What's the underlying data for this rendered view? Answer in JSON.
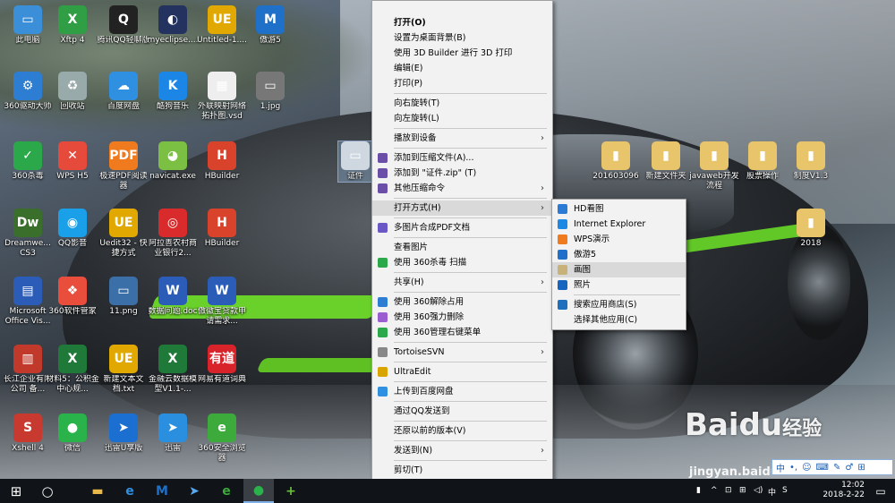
{
  "desktop_icons": [
    {
      "label": "此电脑",
      "bg": "#3a8fd8",
      "glyph": "▭"
    },
    {
      "label": "Xftp 4",
      "bg": "#2f9e44",
      "glyph": "X"
    },
    {
      "label": "腾讯QQ轻聊版",
      "bg": "#222",
      "glyph": "Q"
    },
    {
      "label": "myeclipse....",
      "bg": "#23325f",
      "glyph": "◐"
    },
    {
      "label": "Untitled-1....",
      "bg": "#e0a800",
      "glyph": "UE"
    },
    {
      "label": "傲游5",
      "bg": "#1e70c8",
      "glyph": "M"
    },
    {
      "label": "360驱动大师",
      "bg": "#2d7dd2",
      "glyph": "⚙"
    },
    {
      "label": "回收站",
      "bg": "#9aa",
      "glyph": "♻"
    },
    {
      "label": "百度网盘",
      "bg": "#2f8fe0",
      "glyph": "☁"
    },
    {
      "label": "酷狗音乐",
      "bg": "#1b86e6",
      "glyph": "K"
    },
    {
      "label": "外联映射网络拓扑图.vsd",
      "bg": "#eee",
      "glyph": "▦"
    },
    {
      "label": "1.jpg",
      "bg": "#777",
      "glyph": "▭"
    },
    {
      "label": "360杀毒",
      "bg": "#2ba84a",
      "glyph": "✓"
    },
    {
      "label": "WPS H5",
      "bg": "#e64a3b",
      "glyph": "✕"
    },
    {
      "label": "极速PDF阅读器",
      "bg": "#f07a1e",
      "glyph": "PDF"
    },
    {
      "label": "navicat.exe",
      "bg": "#7bc043",
      "glyph": "◕"
    },
    {
      "label": "HBuilder",
      "bg": "#d9432b",
      "glyph": "H"
    },
    {
      "label": "证件",
      "bg": "#cfd8e0",
      "glyph": "▭"
    },
    {
      "label": "Dreamwe... CS3",
      "bg": "#3a6e2b",
      "glyph": "Dw"
    },
    {
      "label": "QQ影音",
      "bg": "#1aa0e8",
      "glyph": "◉"
    },
    {
      "label": "Uedit32 - 快捷方式",
      "bg": "#e0a800",
      "glyph": "UE"
    },
    {
      "label": "阿拉善农村商业银行2...",
      "bg": "#d92b2b",
      "glyph": "◎"
    },
    {
      "label": "HBuilder",
      "bg": "#d9432b",
      "glyph": "H"
    },
    {
      "label": "Microsoft Office Vis...",
      "bg": "#2b5db8",
      "glyph": "▤"
    },
    {
      "label": "360软件管家",
      "bg": "#e94e3c",
      "glyph": "❖"
    },
    {
      "label": "11.png",
      "bg": "#3b6fa8",
      "glyph": "▭"
    },
    {
      "label": "数据问题.doc",
      "bg": "#2b5db8",
      "glyph": "W"
    },
    {
      "label": "傲徽宝贷款申请需求...",
      "bg": "#2b5db8",
      "glyph": "W"
    },
    {
      "label": "长江企业有限公司 备...",
      "bg": "#c0392b",
      "glyph": "▥"
    },
    {
      "label": "材料5：公积金中心规...",
      "bg": "#1f7a3a",
      "glyph": "X"
    },
    {
      "label": "新建文本文档.txt",
      "bg": "#e0a800",
      "glyph": "UE"
    },
    {
      "label": "金融云数据模型V1.1-...",
      "bg": "#1f7a3a",
      "glyph": "X"
    },
    {
      "label": "网易有道词典",
      "bg": "#d9232b",
      "glyph": "有道"
    },
    {
      "label": "Xshell 4",
      "bg": "#c83a2f",
      "glyph": "S"
    },
    {
      "label": "微信",
      "bg": "#2ab34a",
      "glyph": "●"
    },
    {
      "label": "迅雷U享版",
      "bg": "#1a6fd1",
      "glyph": "➤"
    },
    {
      "label": "迅雷",
      "bg": "#2b8fe0",
      "glyph": "➤"
    },
    {
      "label": "360安全浏览器",
      "bg": "#3cab3c",
      "glyph": "e"
    },
    {
      "label": "201603096",
      "bg": "#e8c46a",
      "glyph": "▮"
    },
    {
      "label": "新建文件夹",
      "bg": "#e8c46a",
      "glyph": "▮"
    },
    {
      "label": "javaweb开发流程",
      "bg": "#e8c46a",
      "glyph": "▮"
    },
    {
      "label": "股票操作",
      "bg": "#e8c46a",
      "glyph": "▮"
    },
    {
      "label": "制度V1.3",
      "bg": "#e8c46a",
      "glyph": "▮"
    },
    {
      "label": "2018",
      "bg": "#e8c46a",
      "glyph": "▮"
    }
  ],
  "context_menu": {
    "items": [
      {
        "label": "打开(O)",
        "bold": true
      },
      {
        "label": "设置为桌面背景(B)"
      },
      {
        "label": "使用 3D Builder 进行 3D 打印"
      },
      {
        "label": "编辑(E)"
      },
      {
        "label": "打印(P)"
      },
      {
        "sep": true
      },
      {
        "label": "向右旋转(T)"
      },
      {
        "label": "向左旋转(L)"
      },
      {
        "sep": true
      },
      {
        "label": "播放到设备",
        "sub": true
      },
      {
        "sep": true
      },
      {
        "label": "添加到压缩文件(A)...",
        "icon": "#6b4ea8"
      },
      {
        "label": "添加到 \"证件.zip\" (T)",
        "icon": "#6b4ea8"
      },
      {
        "label": "其他压缩命令",
        "sub": true,
        "icon": "#6b4ea8"
      },
      {
        "sep": true
      },
      {
        "label": "打开方式(H)",
        "sub": true,
        "highlight": true
      },
      {
        "sep": true
      },
      {
        "label": "多图片合成PDF文档",
        "icon": "#6b57c6"
      },
      {
        "sep": true
      },
      {
        "label": "查看图片"
      },
      {
        "label": "使用 360杀毒 扫描",
        "icon": "#2ba84a"
      },
      {
        "sep": true
      },
      {
        "label": "共享(H)",
        "sub": true
      },
      {
        "sep": true
      },
      {
        "label": "使用 360解除占用",
        "icon": "#2d7dd2"
      },
      {
        "label": "使用 360强力删除",
        "icon": "#9a5ed1"
      },
      {
        "label": "使用 360管理右键菜单",
        "icon": "#2ba84a"
      },
      {
        "sep": true
      },
      {
        "label": "TortoiseSVN",
        "sub": true,
        "icon": "#888"
      },
      {
        "sep": true
      },
      {
        "label": "UltraEdit",
        "icon": "#d9a400"
      },
      {
        "sep": true
      },
      {
        "label": "上传到百度网盘",
        "icon": "#2f8fe0"
      },
      {
        "sep": true
      },
      {
        "label": "通过QQ发送到"
      },
      {
        "sep": true
      },
      {
        "label": "还原以前的版本(V)"
      },
      {
        "sep": true
      },
      {
        "label": "发送到(N)",
        "sub": true
      },
      {
        "sep": true
      },
      {
        "label": "剪切(T)"
      }
    ],
    "more_arrow": "▼"
  },
  "submenu": {
    "items": [
      {
        "label": "HD看图",
        "icon": "#2b7bd6"
      },
      {
        "label": "Internet Explorer",
        "icon": "#1e88e5"
      },
      {
        "label": "WPS演示",
        "icon": "#f07a1e"
      },
      {
        "label": "傲游5",
        "icon": "#1e70c8"
      },
      {
        "label": "画图",
        "icon": "#c9b27a",
        "highlight": true
      },
      {
        "label": "照片",
        "icon": "#1565c0"
      },
      {
        "sep": true
      },
      {
        "label": "搜索应用商店(S)",
        "icon": "#1f6fbf"
      },
      {
        "label": "选择其他应用(C)"
      }
    ]
  },
  "taskbar": {
    "start": "⊞",
    "search": "○",
    "apps": [
      {
        "name": "file-explorer",
        "glyph": "▬",
        "color": "#e8b84a"
      },
      {
        "name": "ie",
        "glyph": "e",
        "color": "#2f8fe0"
      },
      {
        "name": "maxthon",
        "glyph": "M",
        "color": "#1e70c8"
      },
      {
        "name": "xunlei",
        "glyph": "➤",
        "color": "#5aa9ef"
      },
      {
        "name": "360-browser",
        "glyph": "e",
        "color": "#3cab3c"
      },
      {
        "name": "wechat",
        "glyph": "●",
        "color": "#2ab34a",
        "active": true
      },
      {
        "name": "360-safe",
        "glyph": "+",
        "color": "#6ac23a"
      }
    ],
    "tray": [
      "▮",
      "^",
      "⊡",
      "⊞",
      "◁)",
      "中",
      "S"
    ],
    "time": "12:02",
    "date": "2018-2-22",
    "notify": "▭"
  },
  "ime_bar": {
    "items": [
      "中",
      "•,",
      "☺",
      "⌨",
      "✎",
      "♂",
      "⊞"
    ]
  },
  "watermark": {
    "brand": "Bai",
    "brand2": "du",
    "suffix": "经验",
    "url": "jingyan.baidu.com"
  }
}
